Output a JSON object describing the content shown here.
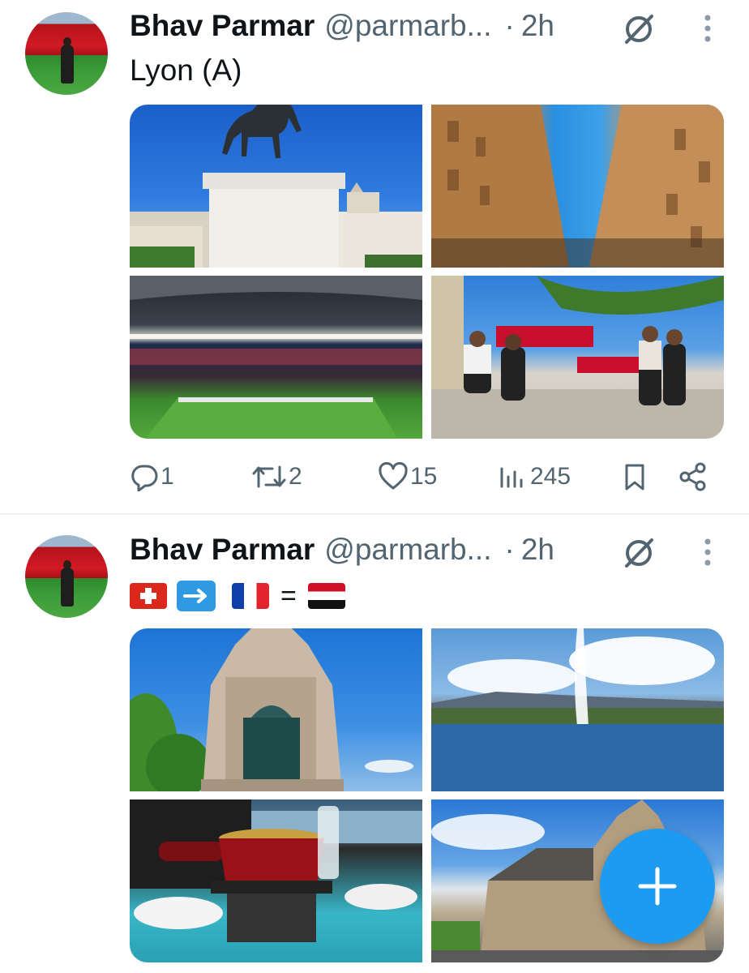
{
  "tweets": [
    {
      "author_name": "Bhav Parmar",
      "handle": "@parmarb...",
      "separator": "·",
      "time": "2h",
      "text": "Lyon (A)",
      "media": [
        "statue-photo",
        "street-photo",
        "stadium-photo",
        "group-photo"
      ],
      "stats": {
        "replies": "1",
        "reposts": "2",
        "likes": "15",
        "views": "245"
      }
    },
    {
      "author_name": "Bhav Parmar",
      "handle": "@parmarb...",
      "separator": "·",
      "time": "2h",
      "emoji_text": {
        "flag_1": "Switzerland flag",
        "arrow": "right-arrow",
        "flag_2": "France flag",
        "equals": "=",
        "flag_3": "Yemen flag"
      },
      "media": [
        "monument-photo",
        "lake-fountain-photo",
        "fondue-photo",
        "cathedral-photo"
      ]
    }
  ],
  "fab": {
    "icon": "plus-icon",
    "color": "#1d9bf0"
  },
  "colors": {
    "accent": "#1d9bf0",
    "secondary_text": "#536471",
    "divider": "#eff3f4"
  }
}
